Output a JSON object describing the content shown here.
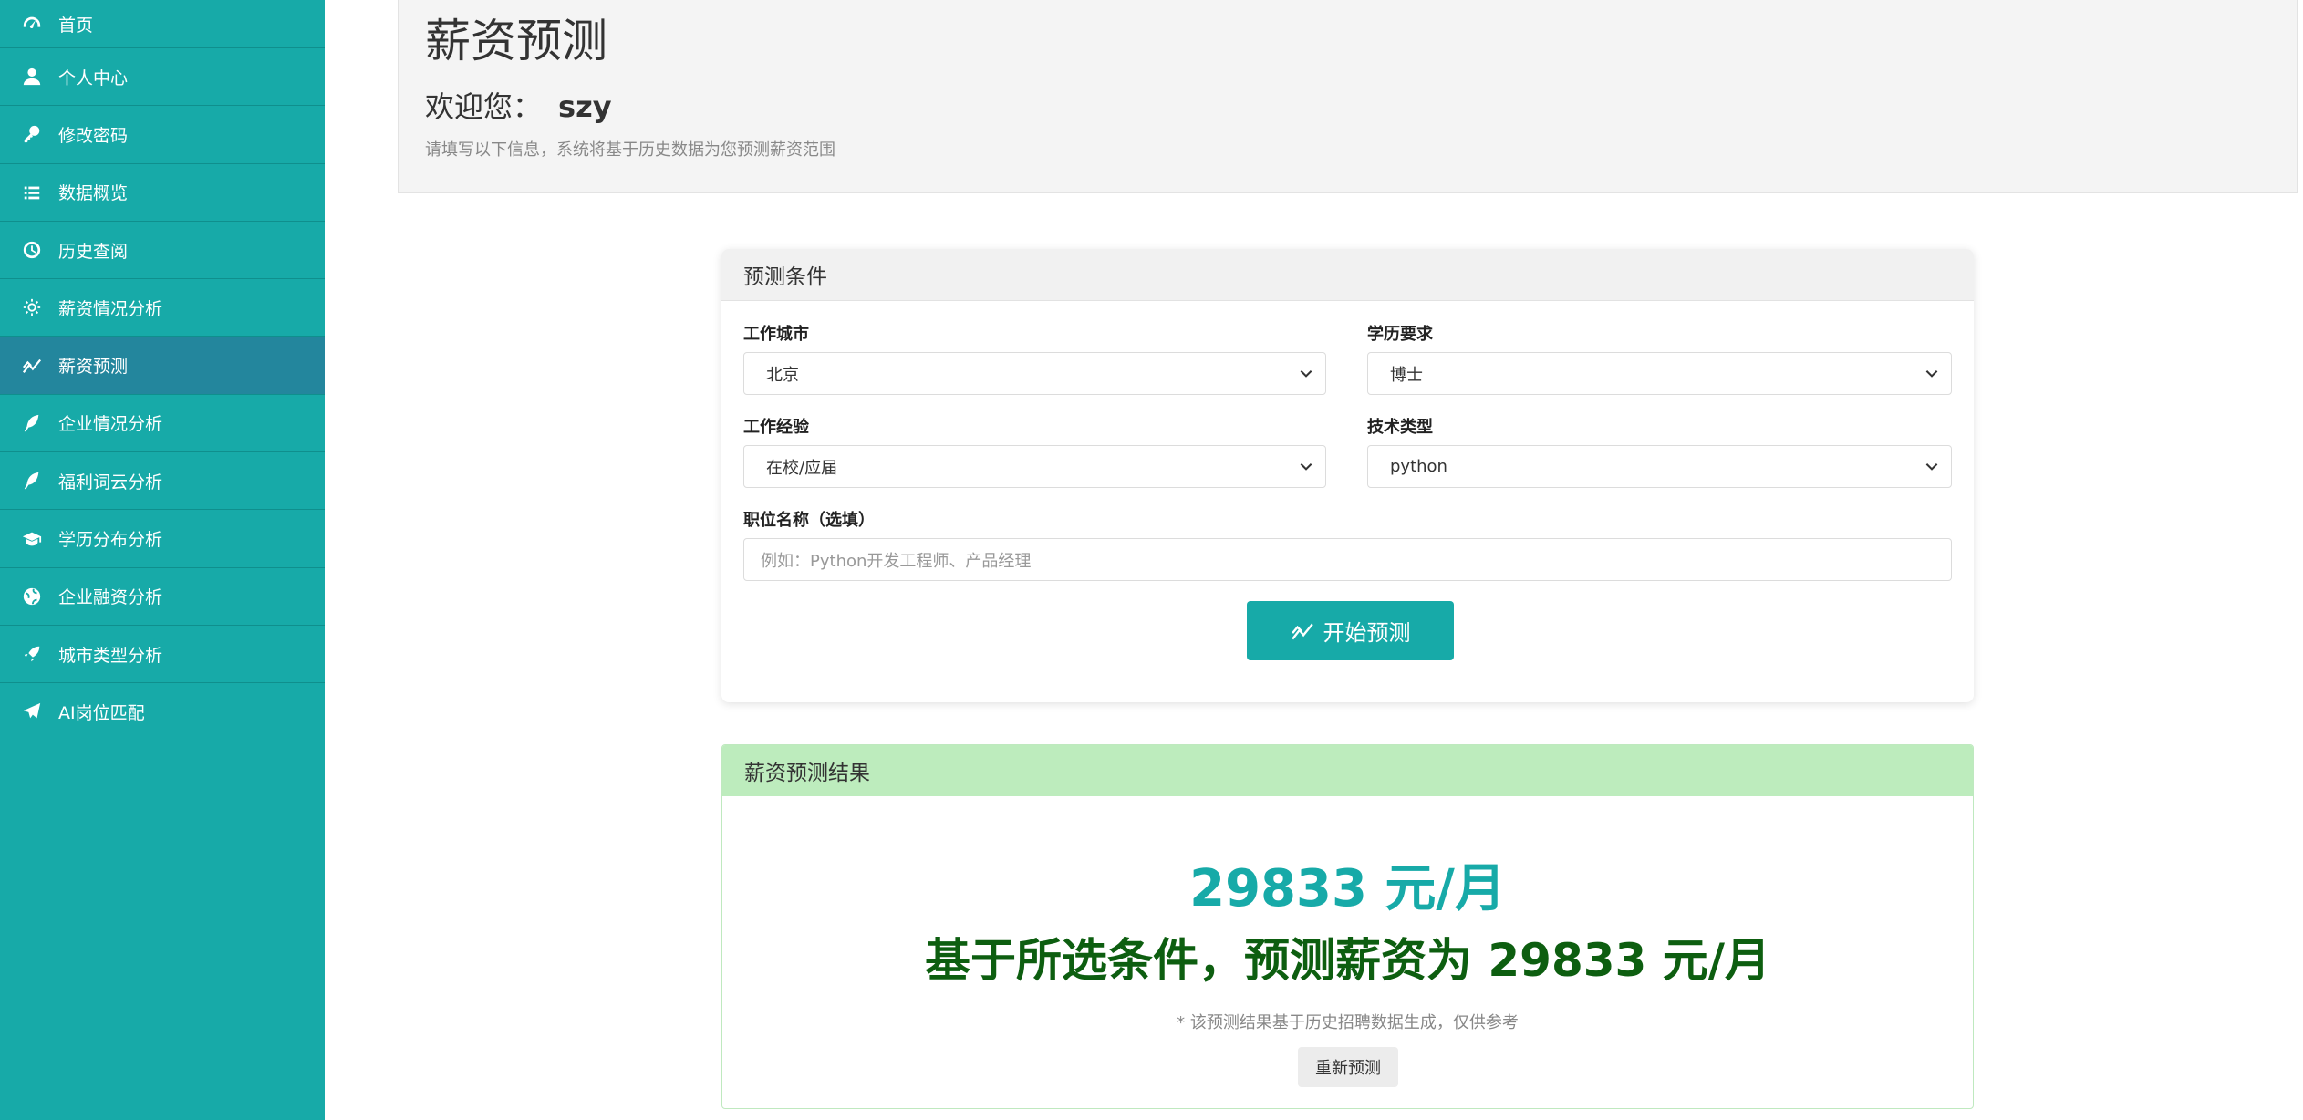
{
  "sidebar": {
    "items": [
      {
        "label": "首页",
        "icon": "dashboard-icon"
      },
      {
        "label": "个人中心",
        "icon": "user-icon"
      },
      {
        "label": "修改密码",
        "icon": "key-icon"
      },
      {
        "label": "数据概览",
        "icon": "list-icon"
      },
      {
        "label": "历史查阅",
        "icon": "clock-icon"
      },
      {
        "label": "薪资情况分析",
        "icon": "sun-icon"
      },
      {
        "label": "薪资预测",
        "icon": "chart-line-icon",
        "active": true
      },
      {
        "label": "企业情况分析",
        "icon": "feather-icon"
      },
      {
        "label": "福利词云分析",
        "icon": "feather-icon"
      },
      {
        "label": "学历分布分析",
        "icon": "graduation-cap-icon"
      },
      {
        "label": "企业融资分析",
        "icon": "globe-icon"
      },
      {
        "label": "城市类型分析",
        "icon": "rocket-icon"
      },
      {
        "label": "AI岗位匹配",
        "icon": "paper-plane-icon"
      }
    ],
    "background": "#17aaa8",
    "active_background": "#23869d"
  },
  "header": {
    "title": "薪资预测",
    "welcome_prefix": "欢迎您：",
    "username": "szy",
    "hint": "请填写以下信息，系统将基于历史数据为您预测薪资范围"
  },
  "form": {
    "card_title": "预测条件",
    "city": {
      "label": "工作城市",
      "value": "北京"
    },
    "education": {
      "label": "学历要求",
      "value": "博士"
    },
    "experience": {
      "label": "工作经验",
      "value": "在校/应届"
    },
    "tech": {
      "label": "技术类型",
      "value": "python"
    },
    "position": {
      "label": "职位名称（选填）",
      "placeholder": "例如：Python开发工程师、产品经理"
    },
    "submit_label": "开始预测"
  },
  "result": {
    "card_title": "薪资预测结果",
    "value": "29833 元/月",
    "summary": "基于所选条件，预测薪资为 29833 元/月",
    "note": "* 该预测结果基于历史招聘数据生成，仅供参考",
    "redo_label": "重新预测"
  },
  "colors": {
    "accent": "#17aaa8",
    "result_header": "#bdecbd",
    "summary_text": "#0d5e10"
  }
}
